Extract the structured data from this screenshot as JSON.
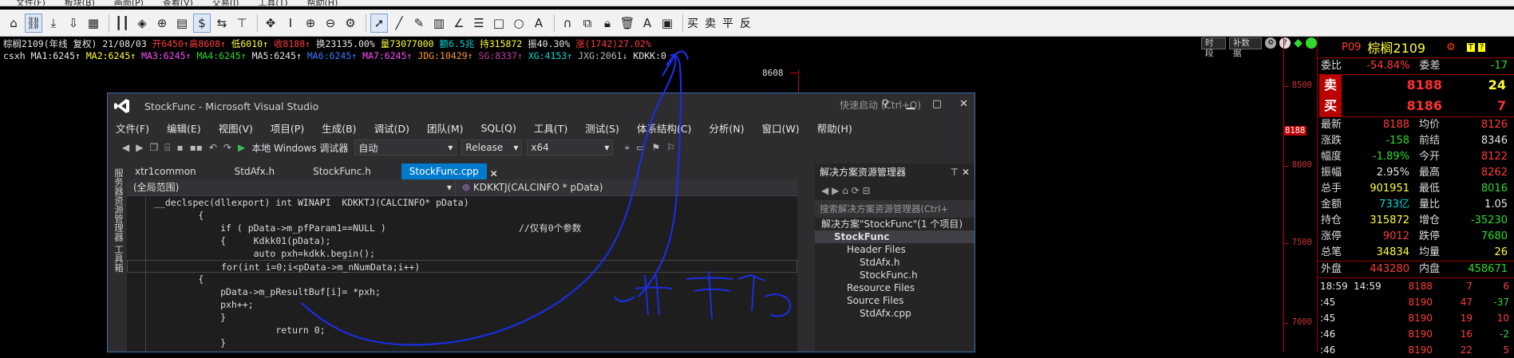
{
  "menu": {
    "items": [
      "文件(F)",
      "板块(B)",
      "画面(P)",
      "查看(V)",
      "交易(J)",
      "工具(T)",
      "帮助(H)"
    ]
  },
  "toolbar": {
    "currency_label": "$",
    "text_buttons": [
      "买",
      "卖",
      "平",
      "反"
    ],
    "icons": [
      "home-icon",
      "link-icon",
      "download-icon",
      "download2-icon",
      "grid-icon",
      "bars-icon",
      "diamond-icon",
      "circle-plus-icon",
      "page-icon",
      "dollar-icon",
      "ab-icon",
      "tee-icon",
      "move-icon",
      "text-icon",
      "zoom-in-icon",
      "zoom-out-icon",
      "gear-icon",
      "cursor-icon",
      "line-icon",
      "pencil-icon",
      "ruler-icon",
      "angle-icon",
      "fib-icon",
      "rect-icon",
      "circle-icon",
      "text-a-icon",
      "magnet-icon",
      "copy-icon",
      "lock-icon",
      "trash-icon",
      "color-icon",
      "save-icon"
    ]
  },
  "chart": {
    "info_line1": [
      {
        "t": "棕榈2109(年线 复权) 21/08/03 ",
        "c": "white"
      },
      {
        "t": "开6450↑",
        "c": "red"
      },
      {
        "t": "高8608↑",
        "c": "red"
      },
      {
        "t": " 低6010↑",
        "c": "yellow"
      },
      {
        "t": " 收8188↑",
        "c": "red"
      },
      {
        "t": " 换23135.00%",
        "c": "white"
      },
      {
        "t": " 量73077000",
        "c": "yellow"
      },
      {
        "t": " 额6.5兆",
        "c": "cyan"
      },
      {
        "t": " 持315872",
        "c": "yellow"
      },
      {
        "t": " 振40.30%",
        "c": "white"
      },
      {
        "t": " 涨(1742)27.02%",
        "c": "red"
      }
    ],
    "info_line2": [
      {
        "t": "csxh MA1:6245↑",
        "c": "white"
      },
      {
        "t": " MA2:6245↑",
        "c": "yellow"
      },
      {
        "t": " MA3:6245↑",
        "c": "magenta"
      },
      {
        "t": " MA4:6245↑",
        "c": "green"
      },
      {
        "t": " MA5:6245↑",
        "c": "white"
      },
      {
        "t": " MA6:6245↑",
        "c": "blue"
      },
      {
        "t": " MA7:6245↑",
        "c": "magenta"
      },
      {
        "t": " JDG:10429↑",
        "c": "orange"
      },
      {
        "t": " SG:8337↑",
        "c": "darkmag"
      },
      {
        "t": " XG:4153↑",
        "c": "cyan"
      },
      {
        "t": " JXG:2061↓",
        "c": "gray"
      },
      {
        "t": " KDKK:0",
        "c": "white"
      }
    ],
    "buttons": [
      "时段",
      "补数据"
    ],
    "marker_value": "8608",
    "axis_labels": [
      "8500",
      "8000",
      "7500",
      "7000"
    ],
    "price_mark": "8188"
  },
  "vs": {
    "title": "StockFunc - Microsoft Visual Studio",
    "quick_launch": "快速启动 (Ctrl+Q)",
    "menu": [
      "文件(F)",
      "编辑(E)",
      "视图(V)",
      "项目(P)",
      "生成(B)",
      "调试(D)",
      "团队(M)",
      "SQL(Q)",
      "工具(T)",
      "测试(S)",
      "体系结构(C)",
      "分析(N)",
      "窗口(W)",
      "帮助(H)"
    ],
    "debugger": "本地 Windows 调试器",
    "config_auto": "自动",
    "config_release": "Release",
    "config_platform": "x64",
    "sidebar_text": "服务器资源管理器  工具箱",
    "tabs": [
      "xtr1common",
      "StdAfx.h",
      "StockFunc.h",
      "StockFunc.cpp"
    ],
    "scope_left": "(全局范围)",
    "scope_right": "KDKKTJ(CALCINFO * pData)",
    "solution": {
      "title": "解决方案资源管理器",
      "search_placeholder": "搜索解决方案资源管理器(Ctrl+",
      "items": [
        {
          "label": "解决方案\"StockFunc\"(1 个项目)",
          "indent": 0
        },
        {
          "label": "StockFunc",
          "indent": 1,
          "sel": true
        },
        {
          "label": "Header Files",
          "indent": 2
        },
        {
          "label": "StdAfx.h",
          "indent": 3
        },
        {
          "label": "StockFunc.h",
          "indent": 3
        },
        {
          "label": "Resource Files",
          "indent": 2
        },
        {
          "label": "Source Files",
          "indent": 2
        },
        {
          "label": "StdAfx.cpp",
          "indent": 3
        }
      ]
    }
  },
  "code_lines": [
    "__declspec(dllexport) int WINAPI  KDKKTJ(CALCINFO* pData)",
    "        {",
    "            if ( pData->m_pfParam1==NULL )                        //仅有0个参数",
    "            {     Kdkk01(pData);",
    "                  auto pxh=kdkk.begin();",
    "            for(int i=0;i<pData->m_nNumData;i++)",
    "        {",
    "            pData->m_pResultBuf[i]= *pxh;",
    "            pxh++;",
    "            }",
    "                      return 0;",
    "            }"
  ],
  "quote": {
    "code": "P09",
    "name": "棕榈2109",
    "weibi_label": "委比",
    "weibi": "-54.84%",
    "weicha_label": "委差",
    "weicha": "-17",
    "sell_label": "卖",
    "sell_price": "8188",
    "sell_vol": "24",
    "buy_label": "买",
    "buy_price": "8186",
    "buy_vol": "7",
    "rows": [
      [
        "最新",
        "8188",
        "均价",
        "8126"
      ],
      [
        "涨跌",
        "-158",
        "前结",
        "8346"
      ],
      [
        "幅度",
        "-1.89%",
        "今开",
        "8122"
      ],
      [
        "振幅",
        "2.95%",
        "最高",
        "8262"
      ],
      [
        "总手",
        "901951",
        "最低",
        "8016"
      ],
      [
        "金额",
        "733亿",
        "量比",
        "1.05"
      ],
      [
        "持仓",
        "315872",
        "增仓",
        "-35230"
      ],
      [
        "涨停",
        "9012",
        "跌停",
        "7680"
      ],
      [
        "总笔",
        "34834",
        "均量",
        "26"
      ]
    ],
    "waipan_label": "外盘",
    "waipan": "443280",
    "neipan_label": "内盘",
    "neipan": "458671",
    "ticks": [
      [
        "18:59",
        "14:59",
        "8188",
        "7",
        "6"
      ],
      [
        ":45",
        "",
        "8190",
        "47",
        "-37"
      ],
      [
        ":45",
        "",
        "8190",
        "19",
        "10"
      ],
      [
        ":46",
        "",
        "8190",
        "16",
        "-2"
      ],
      [
        ":46",
        "",
        "8190",
        "22",
        "5"
      ]
    ]
  }
}
